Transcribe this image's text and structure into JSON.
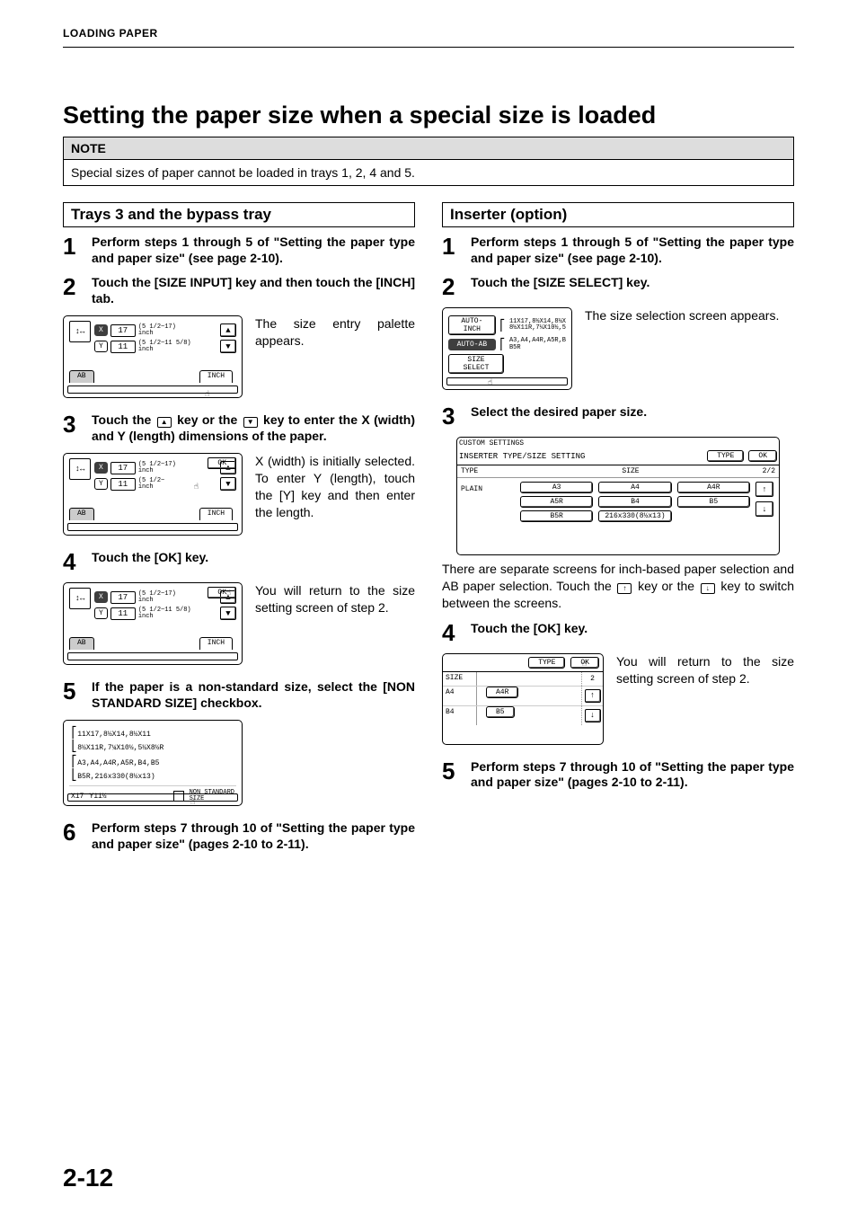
{
  "running_head": "LOADING PAPER",
  "title": "Setting the paper size when a special size is loaded",
  "note": {
    "label": "NOTE",
    "body": "Special sizes of paper cannot be loaded in trays 1, 2, 4 and 5."
  },
  "left": {
    "heading": "Trays 3 and the bypass tray",
    "s1": {
      "n": "1",
      "t": "Perform steps 1 through 5 of \"Setting the paper type and paper size\" (see page 2-10)."
    },
    "s2": {
      "n": "2",
      "t": "Touch the [SIZE INPUT] key and then touch the [INCH] tab.",
      "desc": "The size entry palette appears."
    },
    "s3": {
      "n": "3",
      "t_pre": "Touch the",
      "t_mid": "key or the",
      "t_post": "key to enter the X (width) and Y (length) dimensions of the paper.",
      "desc": "X (width) is initially selected. To enter Y (length), touch the [Y] key and then enter the length."
    },
    "s4": {
      "n": "4",
      "t": "Touch the [OK] key.",
      "desc": "You will return to the size setting screen of step 2."
    },
    "s5": {
      "n": "5",
      "t": "If the paper is a non-standard size, select the [NON STANDARD SIZE] checkbox."
    },
    "s6": {
      "n": "6",
      "t": "Perform steps 7 through 10 of \"Setting the paper type and paper size\" (pages 2-10 to 2-11)."
    },
    "panel": {
      "x": "X",
      "y": "Y",
      "xv": "17",
      "yv": "11",
      "xh": "(5 1/2~17)\ninch",
      "yh": "(5 1/2~11 5/8)\ninch",
      "ab": "AB",
      "inch": "INCH",
      "ok": "OK"
    },
    "nonstd": {
      "l1a": "11X17,8½X14,8½X11",
      "l1b": "8½X11R,7¼X10½,5½X8½R",
      "l2a": "A3,A4,A4R,A5R,B4,B5",
      "l2b": "B5R,216x330(8½x13)",
      "x": "X17",
      "y": "Y11½",
      "ck": "NON STANDARD\nSIZE"
    }
  },
  "right": {
    "heading": "Inserter (option)",
    "s1": {
      "n": "1",
      "t": "Perform steps 1 through 5 of \"Setting the paper type and paper size\" (see page 2-10)."
    },
    "s2": {
      "n": "2",
      "t": "Touch the [SIZE SELECT] key.",
      "desc": "The size selection screen appears."
    },
    "s3": {
      "n": "3",
      "t": "Select the desired paper size.",
      "below": "There are separate screens for inch-based paper selection and AB paper selection. Touch the",
      "below2": "key or the",
      "below3": "key to switch between the screens."
    },
    "s4": {
      "n": "4",
      "t": "Touch the [OK] key.",
      "desc": "You will return to the size setting screen of step 2."
    },
    "s5": {
      "n": "5",
      "t": "Perform steps 7 through 10 of \"Setting the paper type and paper size\" (pages 2-10 to 2-11)."
    },
    "auto": {
      "ai": "AUTO-INCH",
      "ab": "AUTO-AB",
      "ss": "SIZE SELECT",
      "ai_t": "11X17,8½X14,8½X\n8½X11R,7¼X10½,5",
      "ab_t": "A3,A4,A4R,A5R,B\nB5R"
    },
    "ins": {
      "head": "CUSTOM SETTINGS",
      "title": "INSERTER TYPE/SIZE SETTING",
      "btn_type": "TYPE",
      "btn_ok": "OK",
      "colA": "TYPE",
      "colB": "SIZE",
      "page": "2/2",
      "plain": "PLAIN",
      "c": [
        "A3",
        "A4",
        "A4R",
        "A5R",
        "B4",
        "B5",
        "B5R",
        "216x330(8½x13)"
      ]
    },
    "ret": {
      "type": "TYPE",
      "ok": "OK",
      "hSize": "SIZE",
      "r1a": "A4",
      "r1b": "A4R",
      "r2a": "B4",
      "r2b": "B5"
    }
  },
  "page_num": "2-12"
}
